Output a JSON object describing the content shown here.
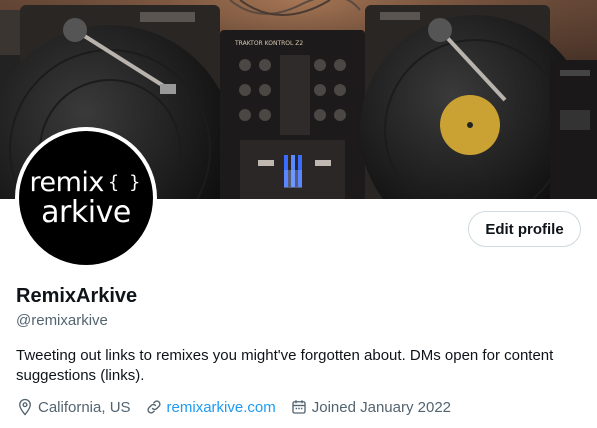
{
  "profile": {
    "avatar": {
      "line1": "remix",
      "braces": "{ }",
      "line2": "arkive"
    },
    "edit_button_label": "Edit profile",
    "display_name": "RemixArkive",
    "handle": "@remixarkive",
    "bio": "Tweeting out links to remixes you might've forgotten about.  DMs open for content suggestions (links).",
    "location": "California, US",
    "website": "remixarkive.com",
    "joined": "Joined January 2022",
    "banner_mixer_brand": "TRAKTOR KONTROL Z2"
  },
  "icons": {
    "location": "location-pin-icon",
    "link": "link-icon",
    "calendar": "calendar-icon"
  },
  "colors": {
    "link": "#1d9bf0",
    "secondary_text": "#536471",
    "primary_text": "#0f1419",
    "button_border": "#cfd9de"
  }
}
